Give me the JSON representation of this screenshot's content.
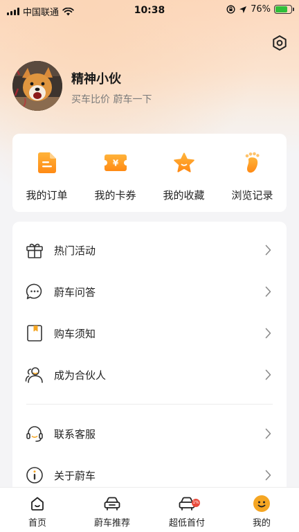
{
  "status_bar": {
    "carrier": "中国联通",
    "time": "10:38",
    "battery": "76%",
    "battery_level": 0.76
  },
  "profile": {
    "name": "精神小伙",
    "slogan": "买车比价 蔚车一下"
  },
  "quick_actions": [
    {
      "label": "我的订单",
      "icon": "order-document-icon",
      "color": "#ff9a1f"
    },
    {
      "label": "我的卡券",
      "icon": "coupon-ticket-icon",
      "color": "#ff9a1f"
    },
    {
      "label": "我的收藏",
      "icon": "star-icon",
      "color": "#ff9a1f"
    },
    {
      "label": "浏览记录",
      "icon": "footprint-icon",
      "color": "#ff9a1f"
    }
  ],
  "menu": {
    "items": [
      {
        "label": "热门活动",
        "icon": "gift-icon"
      },
      {
        "label": "蔚车问答",
        "icon": "chat-bubble-icon"
      },
      {
        "label": "购车须知",
        "icon": "notice-book-icon"
      },
      {
        "label": "成为合伙人",
        "icon": "partner-people-icon"
      },
      {
        "label": "联系客服",
        "icon": "headset-icon"
      },
      {
        "label": "关于蔚车",
        "icon": "info-icon"
      }
    ]
  },
  "tab_bar": {
    "tabs": [
      {
        "label": "首页",
        "icon": "home-icon",
        "active": false
      },
      {
        "label": "蔚车推荐",
        "icon": "car-icon",
        "active": false
      },
      {
        "label": "超低首付",
        "icon": "car-discount-icon",
        "active": false,
        "badge": "1%"
      },
      {
        "label": "我的",
        "icon": "smiley-face-icon",
        "active": true
      }
    ]
  },
  "colors": {
    "accent": "#ff9a1f",
    "active_tab": "#f5a623",
    "badge": "#e94b3c"
  }
}
